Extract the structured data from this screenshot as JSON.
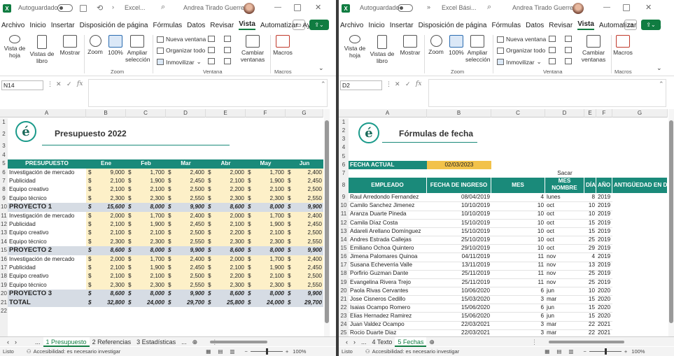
{
  "left": {
    "autosave_label": "Autoguardado",
    "file_title": "Excel...",
    "user_name": "Andrea Tirado Guerrero",
    "menu": [
      "Archivo",
      "Inicio",
      "Insertar",
      "Disposición de página",
      "Fórmulas",
      "Datos",
      "Revisar",
      "Vista",
      "Automatizar",
      "Ayuda"
    ],
    "ribbon": {
      "vista_hoja": "Vista de hoja",
      "vistas_libro": "Vistas de libro",
      "mostrar": "Mostrar",
      "zoom": "Zoom",
      "zoom100": "100%",
      "ampliar": "Ampliar selección",
      "nueva_ventana": "Nueva ventana",
      "organizar": "Organizar todo",
      "inmovilizar": "Inmovilizar",
      "cambiar": "Cambiar ventanas",
      "macros": "Macros",
      "g_zoom": "Zoom",
      "g_ventana": "Ventana",
      "g_macros": "Macros"
    },
    "namebox": "N14",
    "columns": [
      "A",
      "B",
      "C",
      "D",
      "E",
      "F",
      "G"
    ],
    "title": "Presupuesto 2022",
    "header": [
      "PRESUPUESTO",
      "Ene",
      "Feb",
      "Mar",
      "Abr",
      "May",
      "Jun"
    ],
    "rows": [
      {
        "n": "6",
        "label": "Investigación de mercado",
        "v": [
          "9,000",
          "1,700",
          "2,400",
          "2,000",
          "1,700",
          "2,400"
        ],
        "k": "item"
      },
      {
        "n": "7",
        "label": "Publicidad",
        "v": [
          "2,100",
          "1,900",
          "2,450",
          "2,100",
          "1,900",
          "2,450"
        ],
        "k": "item"
      },
      {
        "n": "8",
        "label": "Equipo creativo",
        "v": [
          "2,100",
          "2,100",
          "2,500",
          "2,200",
          "2,100",
          "2,500"
        ],
        "k": "item"
      },
      {
        "n": "9",
        "label": "Equipo técnico",
        "v": [
          "2,300",
          "2,300",
          "2,550",
          "2,300",
          "2,300",
          "2,550"
        ],
        "k": "item"
      },
      {
        "n": "10",
        "label": "PROYECTO 1",
        "v": [
          "15,600",
          "8,000",
          "9,900",
          "8,600",
          "8,000",
          "9,900"
        ],
        "k": "total"
      },
      {
        "n": "11",
        "label": "Investigación de mercado",
        "v": [
          "2,000",
          "1,700",
          "2,400",
          "2,000",
          "1,700",
          "2,400"
        ],
        "k": "item"
      },
      {
        "n": "12",
        "label": "Publicidad",
        "v": [
          "2,100",
          "1,900",
          "2,450",
          "2,100",
          "1,900",
          "2,450"
        ],
        "k": "item"
      },
      {
        "n": "13",
        "label": "Equipo creativo",
        "v": [
          "2,100",
          "2,100",
          "2,500",
          "2,200",
          "2,100",
          "2,500"
        ],
        "k": "item"
      },
      {
        "n": "14",
        "label": "Equipo técnico",
        "v": [
          "2,300",
          "2,300",
          "2,550",
          "2,300",
          "2,300",
          "2,550"
        ],
        "k": "item"
      },
      {
        "n": "15",
        "label": "PROYECTO 2",
        "v": [
          "8,600",
          "8,000",
          "9,900",
          "8,600",
          "8,000",
          "9,900"
        ],
        "k": "total"
      },
      {
        "n": "16",
        "label": "Investigación de mercado",
        "v": [
          "2,000",
          "1,700",
          "2,400",
          "2,000",
          "1,700",
          "2,400"
        ],
        "k": "item"
      },
      {
        "n": "17",
        "label": "Publicidad",
        "v": [
          "2,100",
          "1,900",
          "2,450",
          "2,100",
          "1,900",
          "2,450"
        ],
        "k": "item"
      },
      {
        "n": "18",
        "label": "Equipo creativo",
        "v": [
          "2,100",
          "2,100",
          "2,500",
          "2,200",
          "2,100",
          "2,500"
        ],
        "k": "item"
      },
      {
        "n": "19",
        "label": "Equipo técnico",
        "v": [
          "2,300",
          "2,300",
          "2,550",
          "2,300",
          "2,300",
          "2,550"
        ],
        "k": "item"
      },
      {
        "n": "20",
        "label": "PROYECTO 3",
        "v": [
          "8,600",
          "8,000",
          "9,900",
          "8,600",
          "8,000",
          "9,900"
        ],
        "k": "total"
      },
      {
        "n": "21",
        "label": "TOTAL",
        "v": [
          "32,800",
          "24,000",
          "29,700",
          "25,800",
          "24,000",
          "29,700"
        ],
        "k": "grand"
      }
    ],
    "currency": "$",
    "tabs": [
      "1 Presupuesto",
      "2 Referencias",
      "3 Estadísticas"
    ],
    "tab_more": "...",
    "status_ready": "Listo",
    "status_access": "Accesibilidad: es necesario investigar",
    "zoom_pct": "100%"
  },
  "right": {
    "autosave_label": "Autoguardado",
    "file_title": "Excel Bási...",
    "user_name": "Andrea Tirado Guerrero",
    "menu": [
      "Archivo",
      "Inicio",
      "Insertar",
      "Disposición de página",
      "Fórmulas",
      "Datos",
      "Revisar",
      "Vista",
      "Automatizar",
      "Ayuda"
    ],
    "namebox": "D2",
    "columns": [
      "A",
      "B",
      "C",
      "D",
      "E",
      "F",
      "G"
    ],
    "title": "Fórmulas de fecha",
    "fecha_label": "FECHA ACTUAL",
    "fecha_value": "02/03/2023",
    "sacar": "Sacar",
    "header": [
      "EMPLEADO",
      "FECHA DE INGRESO",
      "MES",
      "MES NOMBRE",
      "DÍA",
      "AÑO",
      "ANTIGÜEDAD EN D"
    ],
    "rows": [
      [
        "9",
        "Raul Arredondo Fernandez",
        "08/04/2019",
        "4",
        "lunes",
        "8",
        "2019"
      ],
      [
        "10",
        "Camilo Sanchez Jimenez",
        "10/10/2019",
        "10",
        "oct",
        "10",
        "2019"
      ],
      [
        "11",
        "Aranza Duarte Pineda",
        "10/10/2019",
        "10",
        "oct",
        "10",
        "2019"
      ],
      [
        "12",
        "Camila Díaz Costa",
        "15/10/2019",
        "10",
        "oct",
        "15",
        "2019"
      ],
      [
        "13",
        "Adareli Arellano Domínguez",
        "15/10/2019",
        "10",
        "oct",
        "15",
        "2019"
      ],
      [
        "14",
        "Andres Estrada Callejas",
        "25/10/2019",
        "10",
        "oct",
        "25",
        "2019"
      ],
      [
        "15",
        "Emiliano Ochoa Quintero",
        "29/10/2019",
        "10",
        "oct",
        "29",
        "2019"
      ],
      [
        "16",
        "Jimena Palomares Quinoa",
        "04/11/2019",
        "11",
        "nov",
        "4",
        "2019"
      ],
      [
        "17",
        "Susana Echeverria Valle",
        "13/11/2019",
        "11",
        "nov",
        "13",
        "2019"
      ],
      [
        "18",
        "Porfirio Guzman Dante",
        "25/11/2019",
        "11",
        "nov",
        "25",
        "2019"
      ],
      [
        "19",
        "Evangelina Rivera Trejo",
        "25/11/2019",
        "11",
        "nov",
        "25",
        "2019"
      ],
      [
        "20",
        "Paola Rivas Cervantes",
        "10/06/2020",
        "6",
        "jun",
        "10",
        "2020"
      ],
      [
        "21",
        "Jose Cisneros Cedillo",
        "15/03/2020",
        "3",
        "mar",
        "15",
        "2020"
      ],
      [
        "22",
        "Isaias Ocampo Romero",
        "15/06/2020",
        "6",
        "jun",
        "15",
        "2020"
      ],
      [
        "23",
        "Elias Hernadez Ramirez",
        "15/06/2020",
        "6",
        "jun",
        "15",
        "2020"
      ],
      [
        "24",
        "Juan Valdez Ocampo",
        "22/03/2021",
        "3",
        "mar",
        "22",
        "2021"
      ],
      [
        "25",
        "Rocio Duarte Diaz",
        "22/03/2021",
        "3",
        "mar",
        "22",
        "2021"
      ]
    ],
    "tabs": [
      "4 Texto",
      "5 Fechas"
    ],
    "tab_more": "...",
    "status_ready": "Listo",
    "status_access": "Accesibilidad: es necesario investigar",
    "zoom_pct": "100%"
  },
  "colors": {
    "teal": "#1a8a7a",
    "cream": "#fdf0c8",
    "gray_total": "#d6dce4",
    "yellow": "#f2c24a",
    "excel_green": "#107c41"
  }
}
